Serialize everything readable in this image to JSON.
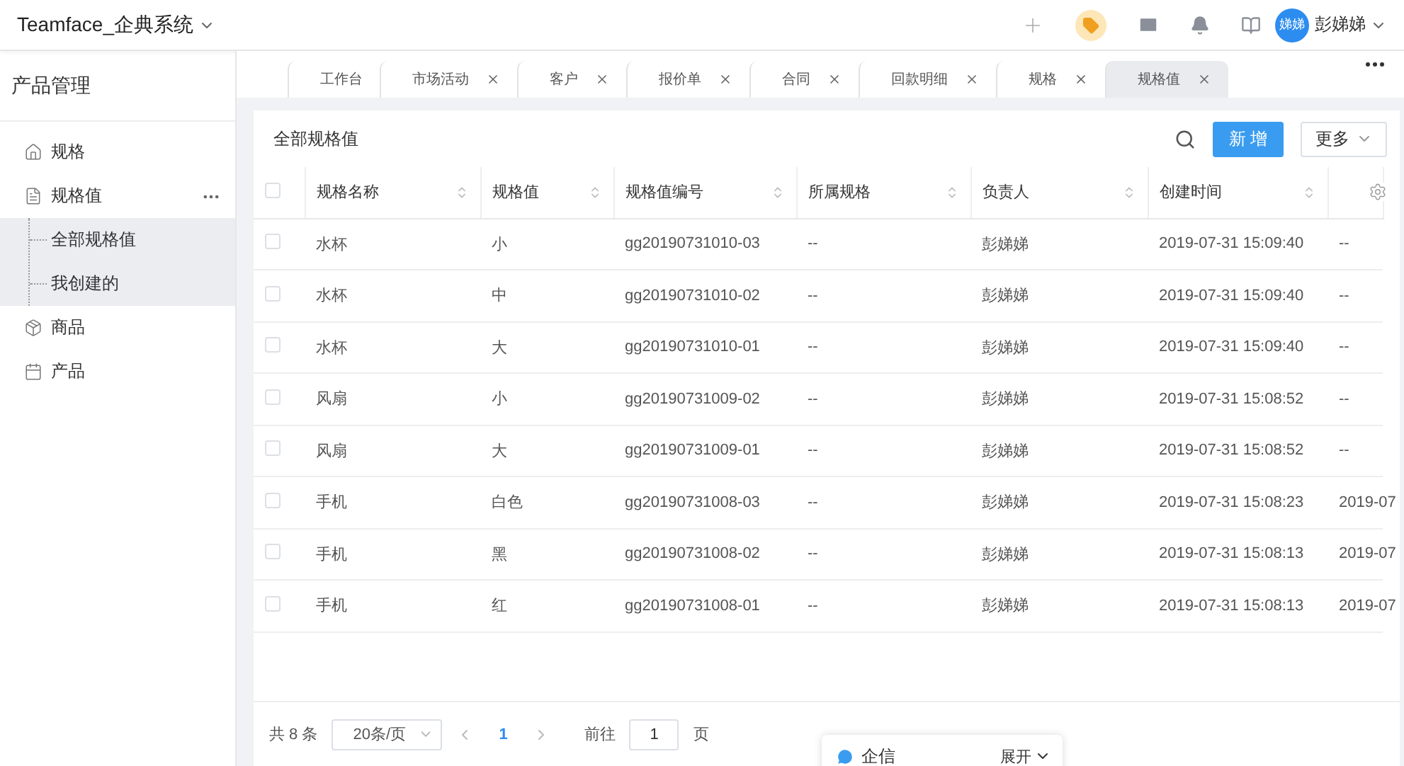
{
  "header": {
    "app_title": "Teamface_企典系统",
    "user_name": "彭娣娣",
    "avatar_text": "娣娣"
  },
  "sidebar": {
    "title": "产品管理",
    "items": [
      {
        "label": "规格",
        "kind": "house",
        "more": false
      },
      {
        "label": "规格值",
        "kind": "doc",
        "more": true,
        "children": [
          {
            "label": "全部规格值"
          },
          {
            "label": "我创建的"
          }
        ]
      },
      {
        "label": "商品",
        "kind": "box",
        "more": false
      },
      {
        "label": "产品",
        "kind": "calendar",
        "more": false
      }
    ]
  },
  "tabs": [
    {
      "label": "工作台",
      "selected": false,
      "closable": false
    },
    {
      "label": "市场活动",
      "selected": false,
      "closable": true
    },
    {
      "label": "客户",
      "selected": false,
      "closable": true
    },
    {
      "label": "报价单",
      "selected": false,
      "closable": true
    },
    {
      "label": "合同",
      "selected": false,
      "closable": true
    },
    {
      "label": "回款明细",
      "selected": false,
      "closable": true
    },
    {
      "label": "规格",
      "selected": false,
      "closable": true
    },
    {
      "label": "规格值",
      "selected": true,
      "closable": true
    }
  ],
  "card": {
    "title": "全部规格值",
    "add_button": "新 增",
    "more_button": "更多"
  },
  "table": {
    "all_checked": false,
    "columns": [
      {
        "label": "规格名称",
        "sortable": true
      },
      {
        "label": "规格值",
        "sortable": true
      },
      {
        "label": "规格值编号",
        "sortable": true
      },
      {
        "label": "所属规格",
        "sortable": true
      },
      {
        "label": "负责人",
        "sortable": true
      },
      {
        "label": "创建时间",
        "sortable": true
      },
      {
        "sortable": false
      }
    ],
    "rows": [
      {
        "checked": false,
        "cells": [
          "水杯",
          "小",
          "gg20190731010-03",
          "--",
          "彭娣娣",
          "2019-07-31 15:09:40",
          "--"
        ]
      },
      {
        "checked": false,
        "cells": [
          "水杯",
          "中",
          "gg20190731010-02",
          "--",
          "彭娣娣",
          "2019-07-31 15:09:40",
          "--"
        ]
      },
      {
        "checked": false,
        "cells": [
          "水杯",
          "大",
          "gg20190731010-01",
          "--",
          "彭娣娣",
          "2019-07-31 15:09:40",
          "--"
        ]
      },
      {
        "checked": false,
        "cells": [
          "风扇",
          "小",
          "gg20190731009-02",
          "--",
          "彭娣娣",
          "2019-07-31 15:08:52",
          "--"
        ]
      },
      {
        "checked": false,
        "cells": [
          "风扇",
          "大",
          "gg20190731009-01",
          "--",
          "彭娣娣",
          "2019-07-31 15:08:52",
          "--"
        ]
      },
      {
        "checked": false,
        "cells": [
          "手机",
          "白色",
          "gg20190731008-03",
          "--",
          "彭娣娣",
          "2019-07-31 15:08:23",
          "2019-07"
        ]
      },
      {
        "checked": false,
        "cells": [
          "手机",
          "黑",
          "gg20190731008-02",
          "--",
          "彭娣娣",
          "2019-07-31 15:08:13",
          "2019-07"
        ]
      },
      {
        "checked": false,
        "cells": [
          "手机",
          "红",
          "gg20190731008-01",
          "--",
          "彭娣娣",
          "2019-07-31 15:08:13",
          "2019-07"
        ]
      }
    ]
  },
  "pagination": {
    "total": "共 8 条",
    "page_size": "20条/页",
    "current_page": "1",
    "goto_label": "前往",
    "goto_value": "1",
    "page_unit": "页"
  },
  "chat": {
    "label": "企信",
    "toggle": "展开"
  }
}
